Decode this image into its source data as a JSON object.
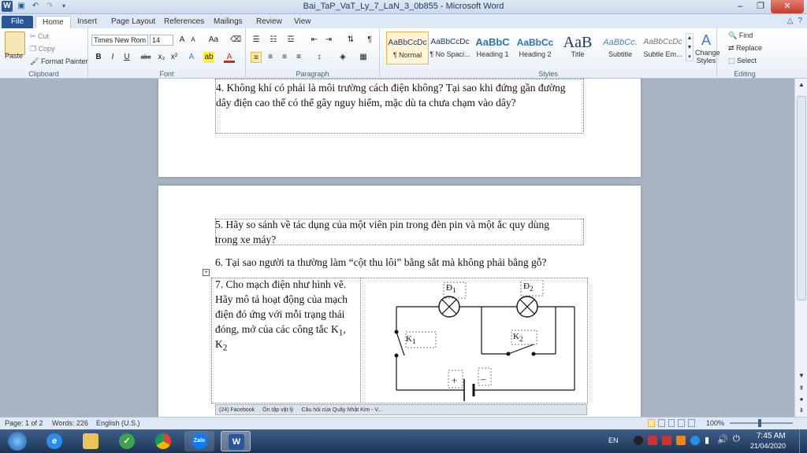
{
  "window": {
    "title": "Bai_TaP_VaT_Ly_7_LaN_3_0b855 - Microsoft Word"
  },
  "tabs": [
    "File",
    "Home",
    "Insert",
    "Page Layout",
    "References",
    "Mailings",
    "Review",
    "View"
  ],
  "ribbon": {
    "clipboard": {
      "paste": "Paste",
      "cut": "Cut",
      "copy": "Copy",
      "format_painter": "Format Painter",
      "label": "Clipboard"
    },
    "font": {
      "name": "Times New Rom",
      "size": "14",
      "label": "Font"
    },
    "paragraph": {
      "label": "Paragraph"
    },
    "styles": {
      "label": "Styles",
      "items": [
        {
          "preview": "AaBbCcDc",
          "name": "¶ Normal"
        },
        {
          "preview": "AaBbCcDc",
          "name": "¶ No Spaci..."
        },
        {
          "preview": "AaBbC",
          "name": "Heading 1"
        },
        {
          "preview": "AaBbCc",
          "name": "Heading 2"
        },
        {
          "preview": "AaB",
          "name": "Title"
        },
        {
          "preview": "AaBbCc.",
          "name": "Subtitle"
        },
        {
          "preview": "AaBbCcDc",
          "name": "Subtle Em..."
        }
      ],
      "change_styles": "Change Styles"
    },
    "editing": {
      "find": "Find",
      "replace": "Replace",
      "select": "Select",
      "label": "Editing"
    }
  },
  "document": {
    "q4_line1": "4. Không khí có phải là môi trường cách điện không? Tại sao khi đứng gần đường",
    "q4_line2": "dây điện cao thế có thể gây nguy hiểm, mặc dù ta chưa chạm vào dây?",
    "q5_line1": "5. Hãy so sánh về tác dụng của một viên pin trong đèn pin và một ắc quy dùng",
    "q5_line2": "trong xe máy?",
    "q6": "6. Tại sao người ta thường làm “cột thu lôi” bằng sắt mà không phải bằng gỗ?",
    "q7_lines": [
      "7. Cho mạch điện như hình vẽ.",
      "Hãy mô tả hoạt động của mạch",
      "điện đó ứng với mỗi trạng thái",
      "đóng, mở của các công tắc K",
      "K"
    ],
    "q7_sub1": "1",
    "q7_sep": ",",
    "q7_sub2": "2",
    "circuit": {
      "d1": "Đ",
      "d1_sub": "1",
      "d2": "Đ",
      "d2_sub": "2",
      "k1": "K",
      "k1_sub": "1",
      "k2": "K",
      "k2_sub": "2",
      "plus": "+",
      "minus": "–"
    },
    "bottom_strip": [
      "(24) Facebook",
      "Ôn tập vật lý",
      "Câu hỏi của Quây Nhật Kim - V..."
    ]
  },
  "status": {
    "page": "Page: 1 of 2",
    "words": "Words: 226",
    "language": "English (U.S.)",
    "zoom": "100%"
  },
  "taskbar": {
    "apps": [
      "Zalo"
    ],
    "lang": "EN",
    "time": "7:45 AM",
    "date": "21/04/2020"
  },
  "colors": {
    "accent": "#2b579a",
    "close": "#c43b2a"
  }
}
